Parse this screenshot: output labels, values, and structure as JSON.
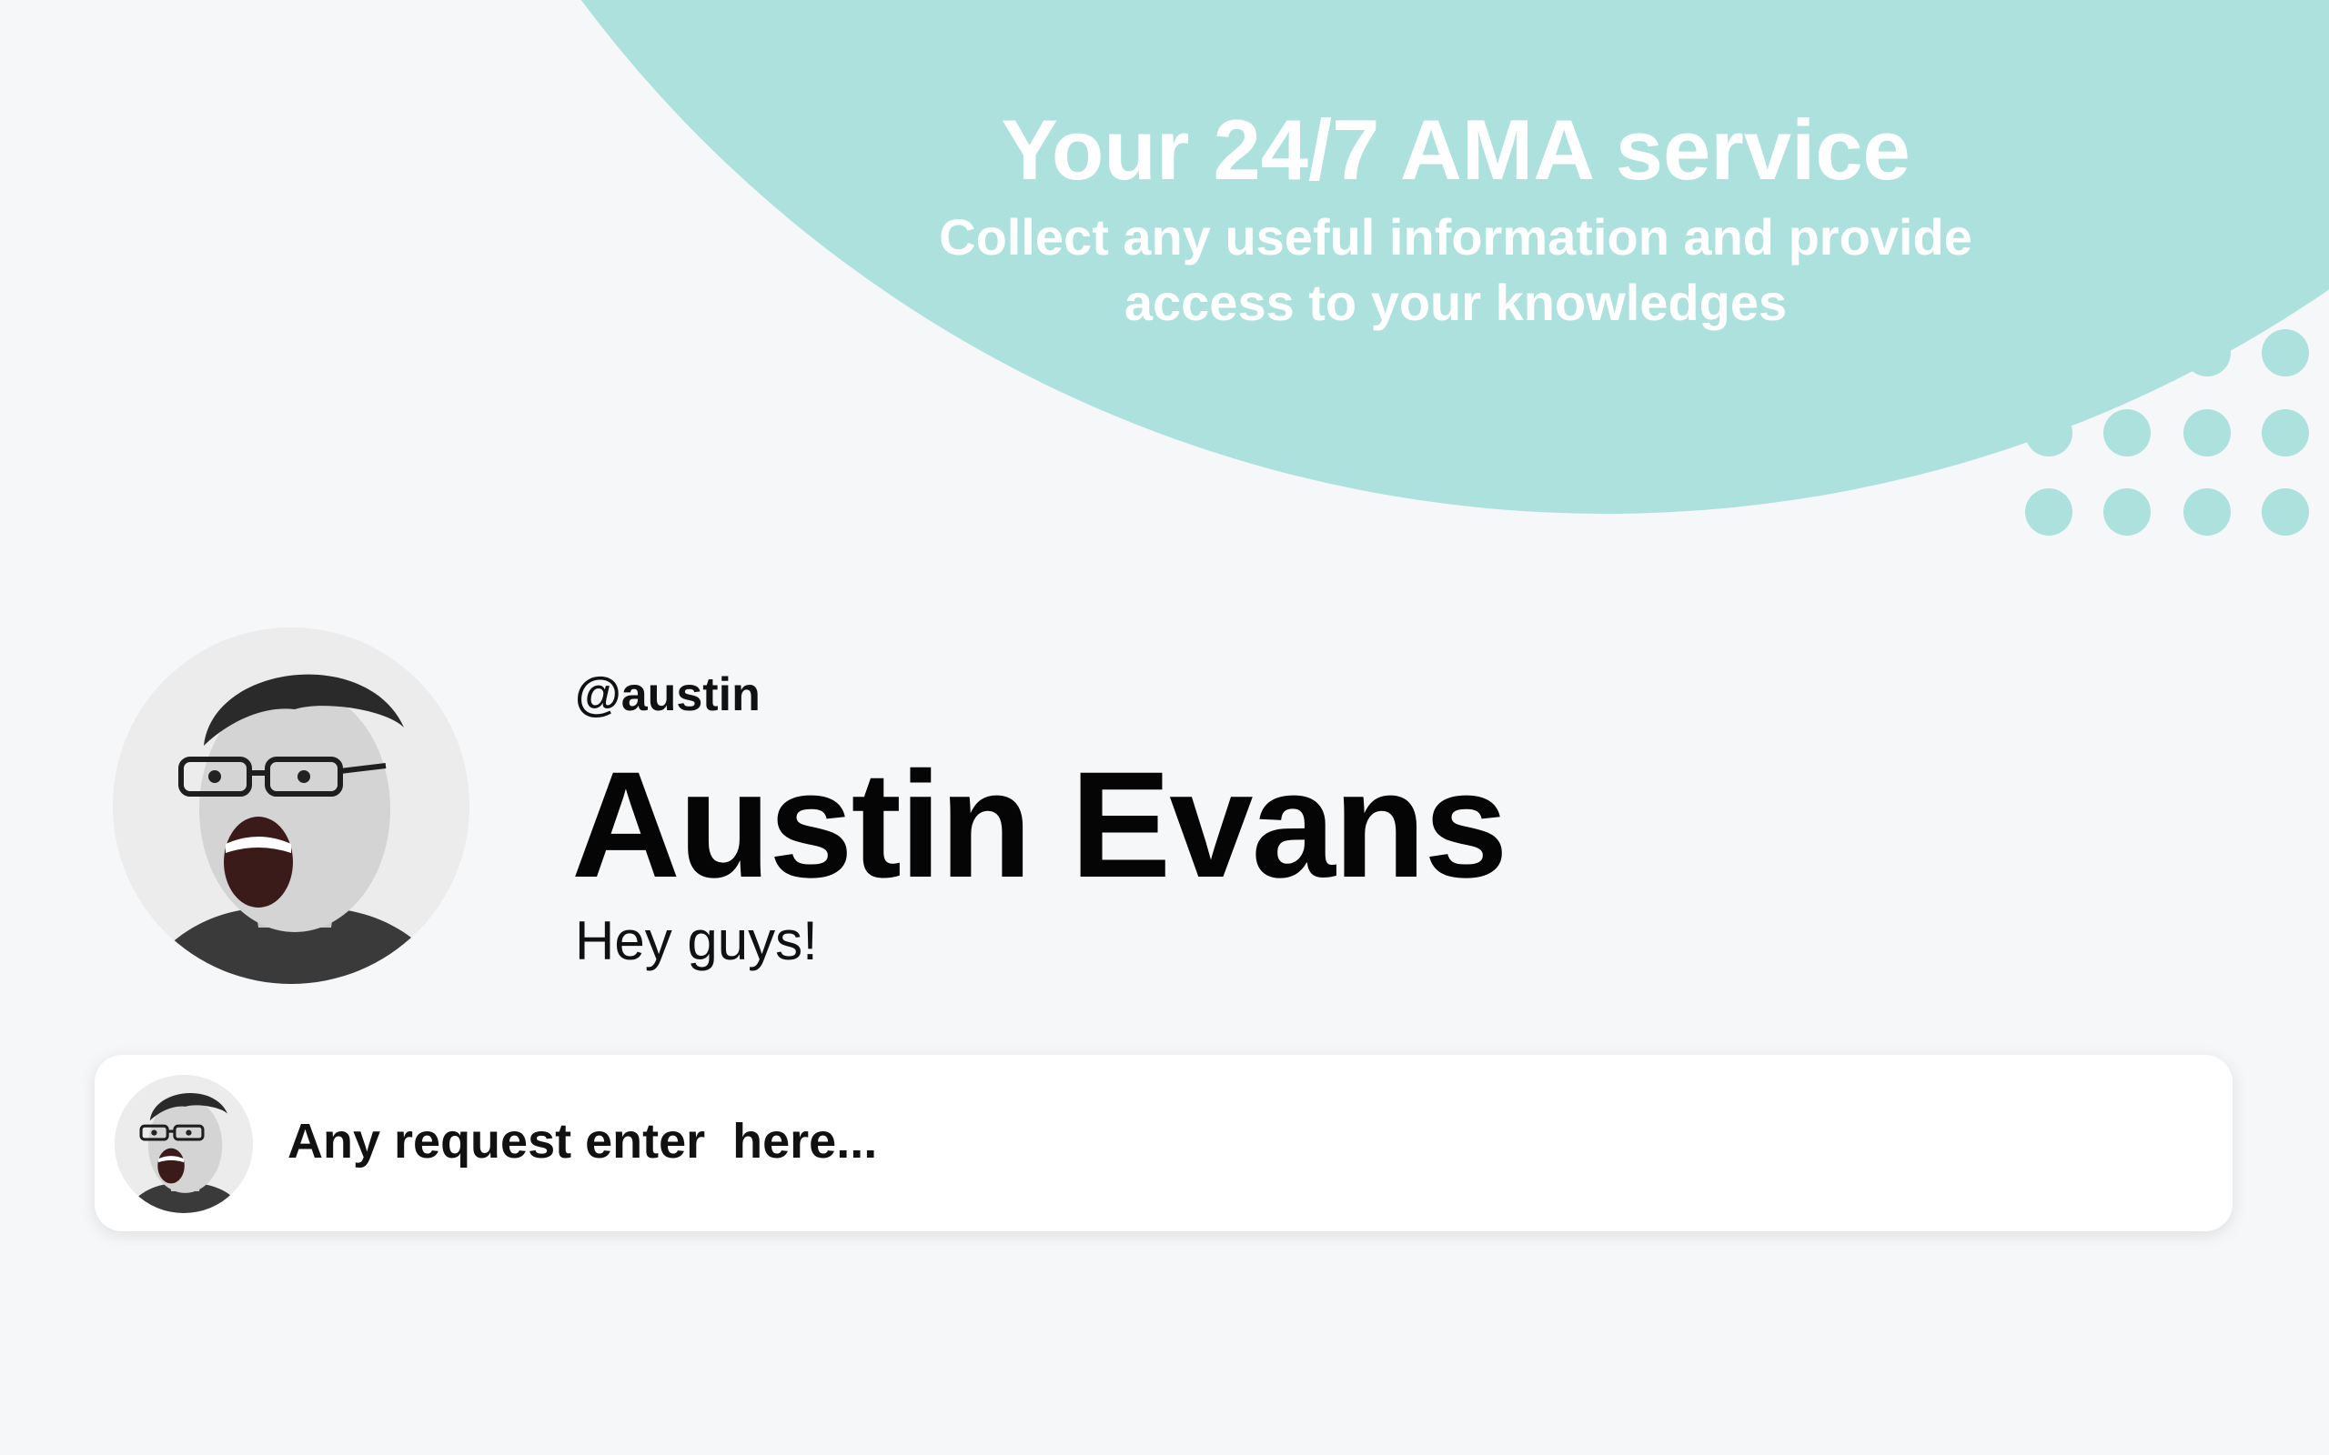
{
  "hero": {
    "title": "Your 24/7 AMA service",
    "subtitle_line1": "Collect any useful information and provide",
    "subtitle_line2": "access to your knowledges"
  },
  "profile": {
    "handle": "@austin",
    "name": "Austin Evans",
    "bio": "Hey guys!"
  },
  "request": {
    "placeholder": "Any request enter  here..."
  },
  "colors": {
    "accent": "#ace1dd",
    "background": "#f6f7f9",
    "card": "#ffffff"
  }
}
